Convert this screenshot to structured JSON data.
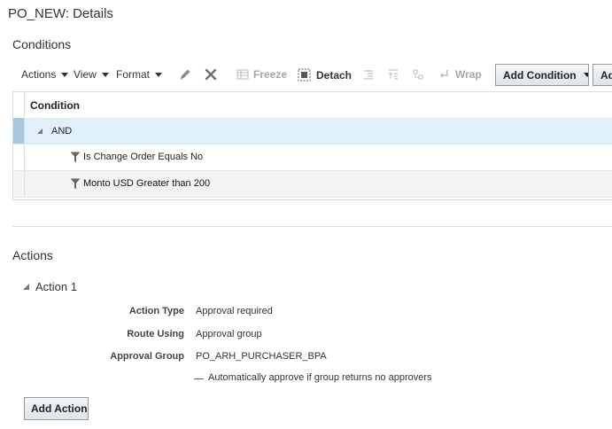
{
  "page": {
    "title": "PO_NEW: Details"
  },
  "conditions": {
    "title": "Conditions",
    "toolbar": {
      "actions_label": "Actions",
      "view_label": "View",
      "format_label": "Format",
      "freeze_label": "Freeze",
      "detach_label": "Detach",
      "wrap_label": "Wrap",
      "add_condition_label": "Add Condition",
      "add_label_partial": "Ad"
    },
    "table": {
      "column_header": "Condition",
      "group_label": "AND",
      "rows": [
        {
          "text": "Is Change Order Equals No"
        },
        {
          "text": "Monto USD Greater than 200"
        }
      ]
    }
  },
  "actions": {
    "title": "Actions",
    "action1_label": "Action 1",
    "fields": {
      "action_type_label": "Action Type",
      "action_type_value": "Approval required",
      "route_using_label": "Route Using",
      "route_using_value": "Approval group",
      "approval_group_label": "Approval Group",
      "approval_group_value": "PO_ARH_PURCHASER_BPA",
      "auto_approve_label": "Automatically approve if group returns no approvers"
    },
    "add_action_label": "Add Action"
  },
  "colors": {
    "selected_row": "#dff0fb",
    "selection_marker": "#a8c6dd",
    "hover_row": "#f4f4f4",
    "text": "#333333"
  }
}
